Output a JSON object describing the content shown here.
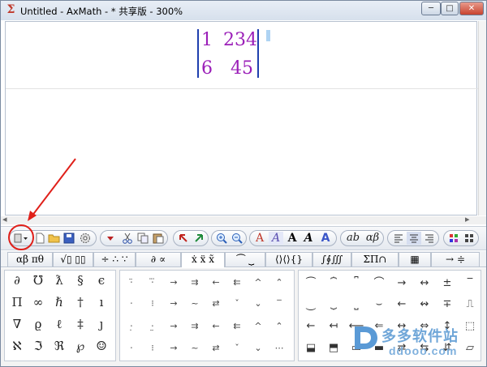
{
  "window": {
    "title": "Untitled - AxMath - * 共享版 - 300%",
    "app_icon": "Σ",
    "buttons": {
      "minimize": "─",
      "maximize": "□",
      "close": "✕"
    }
  },
  "document": {
    "determinant": {
      "r1c1": "1",
      "r1c2": "234",
      "r2c1": "6",
      "r2c2": "45"
    }
  },
  "scrollbar": {
    "left_arrow": "◂",
    "right_arrow": "▸"
  },
  "toolbar": {
    "file_group": [
      "template-dropdown-icon",
      "new-file-icon",
      "open-folder-icon",
      "save-disk-icon",
      "settings-gear-icon"
    ],
    "edit_group": [
      "dropdown-icon",
      "cut-icon",
      "copy-icon",
      "paste-icon"
    ],
    "nav_group": [
      "select-arrow-icon",
      "move-arrow-icon"
    ],
    "zoom_group": [
      "zoom-in-icon",
      "zoom-out-icon"
    ],
    "font_style_labels": [
      "A",
      "A",
      "A",
      "A",
      "A"
    ],
    "text_mode_labels": [
      "ab",
      "αβ"
    ],
    "align_group": [
      "align-left-icon",
      "align-center-icon",
      "align-right-icon"
    ],
    "color_group": [
      "color-palette-icon",
      "color-dropdown-icon"
    ]
  },
  "tabs": [
    "αβ πθ",
    "√▯ ▯▯",
    "÷ ∴ ∵",
    "∂ ∝",
    "ẋ ẍ x̃",
    "⏜ ⏟",
    "⟨⟩⟨⟩{}",
    "∫∮∭",
    "ΣΠ∩",
    "▦",
    "→ ≑"
  ],
  "palette": {
    "symbols": [
      [
        "∂",
        "℧",
        "ƛ",
        "§",
        "ϵ"
      ],
      [
        "Π",
        "∞",
        "ℏ",
        "†",
        "ı"
      ],
      [
        "∇",
        "ϱ",
        "ℓ",
        "‡",
        "ȷ"
      ],
      [
        "ℵ",
        "ℑ",
        "ℜ",
        "℘",
        "☺"
      ]
    ],
    "accents_rows": [
      [
        "⋅̈",
        "⋅⃛",
        "→",
        "⇉",
        "←",
        "⇇",
        "^",
        "⌃"
      ],
      [
        "⋅",
        "⁝",
        "→",
        "~",
        "⇄",
        "ˇ",
        "⌄",
        "‾"
      ],
      [
        "⋅̣",
        "⋅̤",
        "→",
        "⇉",
        "←",
        "⇇",
        "^",
        "⌃"
      ],
      [
        "⋅",
        "⁝",
        "→",
        "~",
        "⇄",
        "ˇ",
        "⌄",
        "⋯"
      ]
    ],
    "brackets_rows": [
      [
        "⏜",
        "⏞",
        "⎴",
        "⌒",
        "→",
        "↔",
        "±",
        "‾"
      ],
      [
        "⏝",
        "⏟",
        "⎵",
        "⌣",
        "←",
        "↭",
        "∓",
        "⎍"
      ],
      [
        "←",
        "↤",
        "⟵",
        "⇐",
        "↔",
        "⇔",
        "↕",
        "⬚"
      ],
      [
        "⬓",
        "⬒",
        "▭",
        "▬",
        "⇄",
        "⇆",
        "⇵",
        "▱"
      ]
    ]
  },
  "watermark": {
    "text": "多多软件站",
    "url": "ddooo.com"
  },
  "colors": {
    "determinant_text": "#9b1fb8",
    "determinant_bar": "#1f3fae",
    "annotation_red": "#e0201a",
    "watermark_blue": "#6fa6d8"
  }
}
